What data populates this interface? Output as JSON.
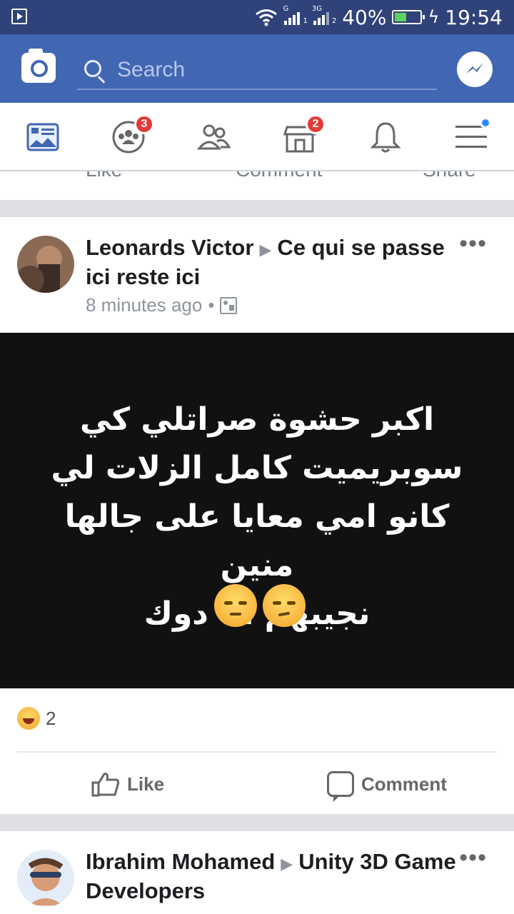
{
  "status_bar": {
    "network_type": "3G",
    "battery": "40%",
    "time": "19:54"
  },
  "top_bar": {
    "search": {
      "placeholder": "Search"
    }
  },
  "nav": {
    "groups_badge": "3",
    "marketplace_badge": "2"
  },
  "previous_post": {
    "actions": [
      "Like",
      "Comment",
      "Share"
    ]
  },
  "posts": [
    {
      "author": "Leonards Victor",
      "group": "Ce qui se passe ici reste ici",
      "time": "8 minutes ago",
      "text_lines": [
        "اكبر حشوة صراتلي كي",
        "سوبريميت كامل الزلات لي",
        "كانو امي معايا على جالها منين",
        "نجيبهم انا دوك"
      ],
      "reaction_count": "2",
      "actions": [
        "Like",
        "Comment"
      ]
    },
    {
      "author": "Ibrahim Mohamed",
      "group": "Unity 3D Game Developers"
    }
  ],
  "colors": {
    "status_bar": "#30427a",
    "brand_blue": "#4267b2",
    "badge_red": "#e53935",
    "notification_dot": "#2d88ff"
  }
}
